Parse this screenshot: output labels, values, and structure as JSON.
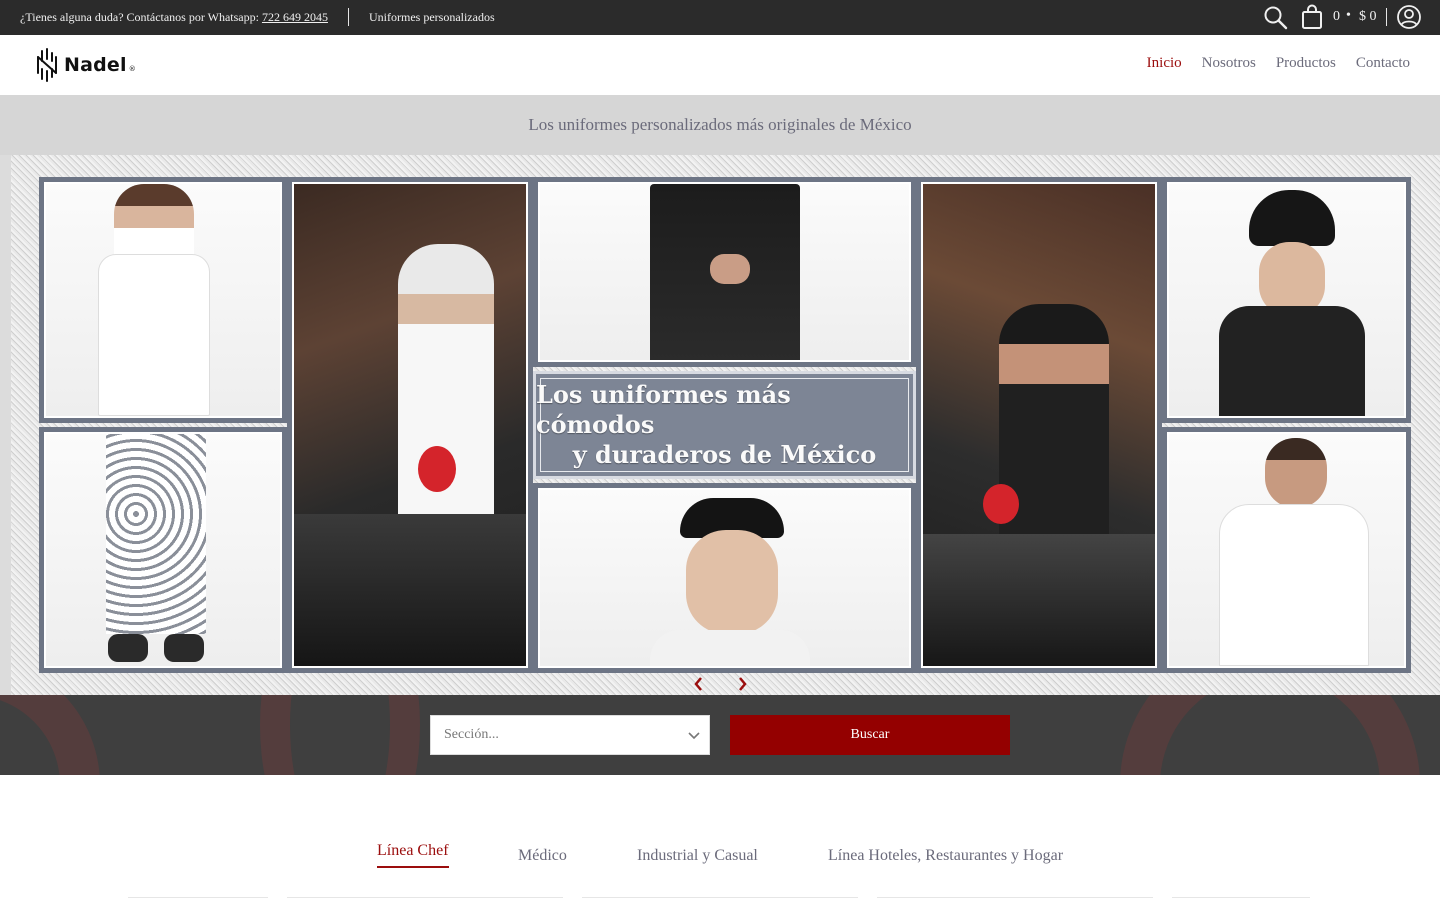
{
  "topbar": {
    "contact_prefix": "¿Tienes alguna duda? Contáctanos por Whatsapp: ",
    "phone": "722 649 2045",
    "tagline": "Uniformes personalizados",
    "cart_count": "0",
    "cart_dot": "•",
    "cart_total": "$ 0",
    "icons": [
      "search-icon",
      "shopping-bag-icon",
      "account-icon"
    ]
  },
  "header": {
    "brand": "Nadel",
    "brand_reg": "®",
    "nav": [
      {
        "label": "Inicio",
        "active": true
      },
      {
        "label": "Nosotros",
        "active": false
      },
      {
        "label": "Productos",
        "active": false
      },
      {
        "label": "Contacto",
        "active": false
      }
    ]
  },
  "announcement": "Los uniformes personalizados más originales de México",
  "hero": {
    "line1": "Los uniformes más cómodos",
    "line2": "y duraderos de México",
    "icons": [
      "chevron-left-icon",
      "chevron-right-icon"
    ]
  },
  "search": {
    "select_placeholder": "Sección...",
    "button_label": "Buscar"
  },
  "tabs": [
    {
      "label": "Línea Chef",
      "active": true
    },
    {
      "label": "Médico",
      "active": false
    },
    {
      "label": "Industrial y Casual",
      "active": false
    },
    {
      "label": "Línea Hoteles, Restaurantes y Hogar",
      "active": false
    }
  ],
  "colors": {
    "accent": "#9b0d0d",
    "topbar_bg": "#2b2b2b",
    "announce_bg": "#d6d6d6",
    "search_button_bg": "#940000"
  }
}
